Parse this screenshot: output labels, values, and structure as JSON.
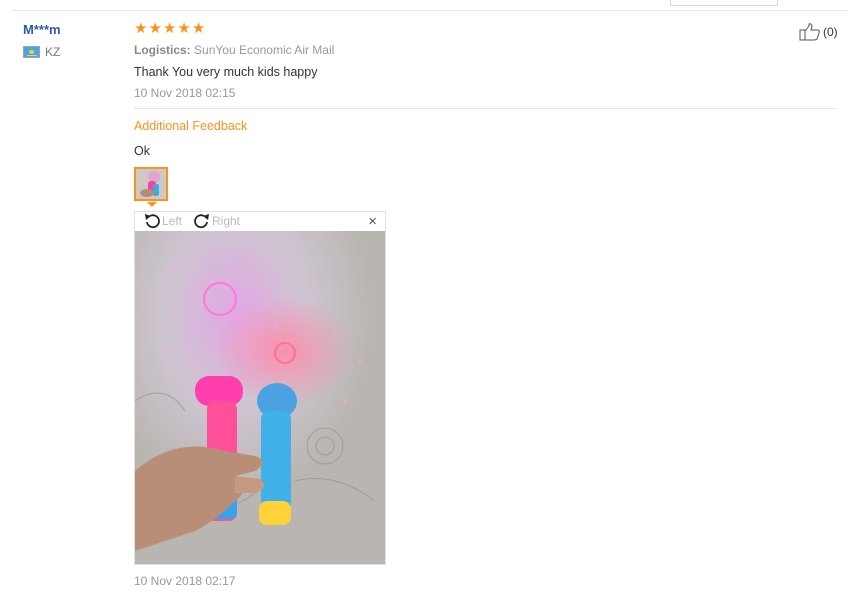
{
  "review": {
    "user": "M***m",
    "country": "KZ",
    "rating": 5,
    "logistics_label": "Logistics:",
    "logistics_value": "SunYou Economic Air Mail",
    "text": "Thank You very much kids happy",
    "date": "10 Nov 2018 02:15",
    "helpful_count": "(0)"
  },
  "additional": {
    "title": "Additional Feedback",
    "text": "Ok",
    "date": "10 Nov 2018 02:17"
  },
  "viewer": {
    "rotate_left_label": "Left",
    "rotate_right_label": "Right",
    "close_symbol": "×"
  },
  "colors": {
    "accent_orange": "#f7931e",
    "username_blue": "#2a5ca8",
    "muted_gray": "#999999"
  },
  "icons": {
    "rating": "star-icon",
    "helpful": "thumbs-up-icon",
    "rotate_left": "rotate-ccw-icon",
    "rotate_right": "rotate-cw-icon",
    "close": "close-icon",
    "country": "flag-kz-icon"
  }
}
